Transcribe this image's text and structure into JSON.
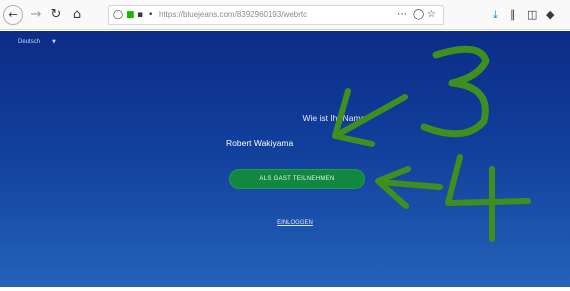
{
  "browser": {
    "url": "https://bluejeans.com/8392960193/webrtc",
    "icons": {
      "back": "arrow-left-icon",
      "forward": "arrow-right-icon",
      "reload": "reload-icon",
      "home": "home-icon",
      "shield": "shield-icon",
      "lock": "lock-icon",
      "permissions": "permissions-icon",
      "microphone": "microphone-icon",
      "more": "ellipsis-icon",
      "pocket": "pocket-icon",
      "bookmark": "star-icon",
      "downloads": "download-icon",
      "library": "library-icon",
      "sidebar": "sidebar-icon",
      "extension": "extension-icon"
    }
  },
  "page": {
    "language": "Deutsch",
    "question": "Wie ist Ihr Name?",
    "name_value": "Robert Wakiyama",
    "join_button": "ALS GAST TEILNEHMEN",
    "login_link": "EINLOGGEN",
    "colors": {
      "background_top": "#0c2c86",
      "background_bottom": "#2462b8",
      "join_button": "#12873f",
      "annotation_ink": "#3f8f1f"
    }
  }
}
